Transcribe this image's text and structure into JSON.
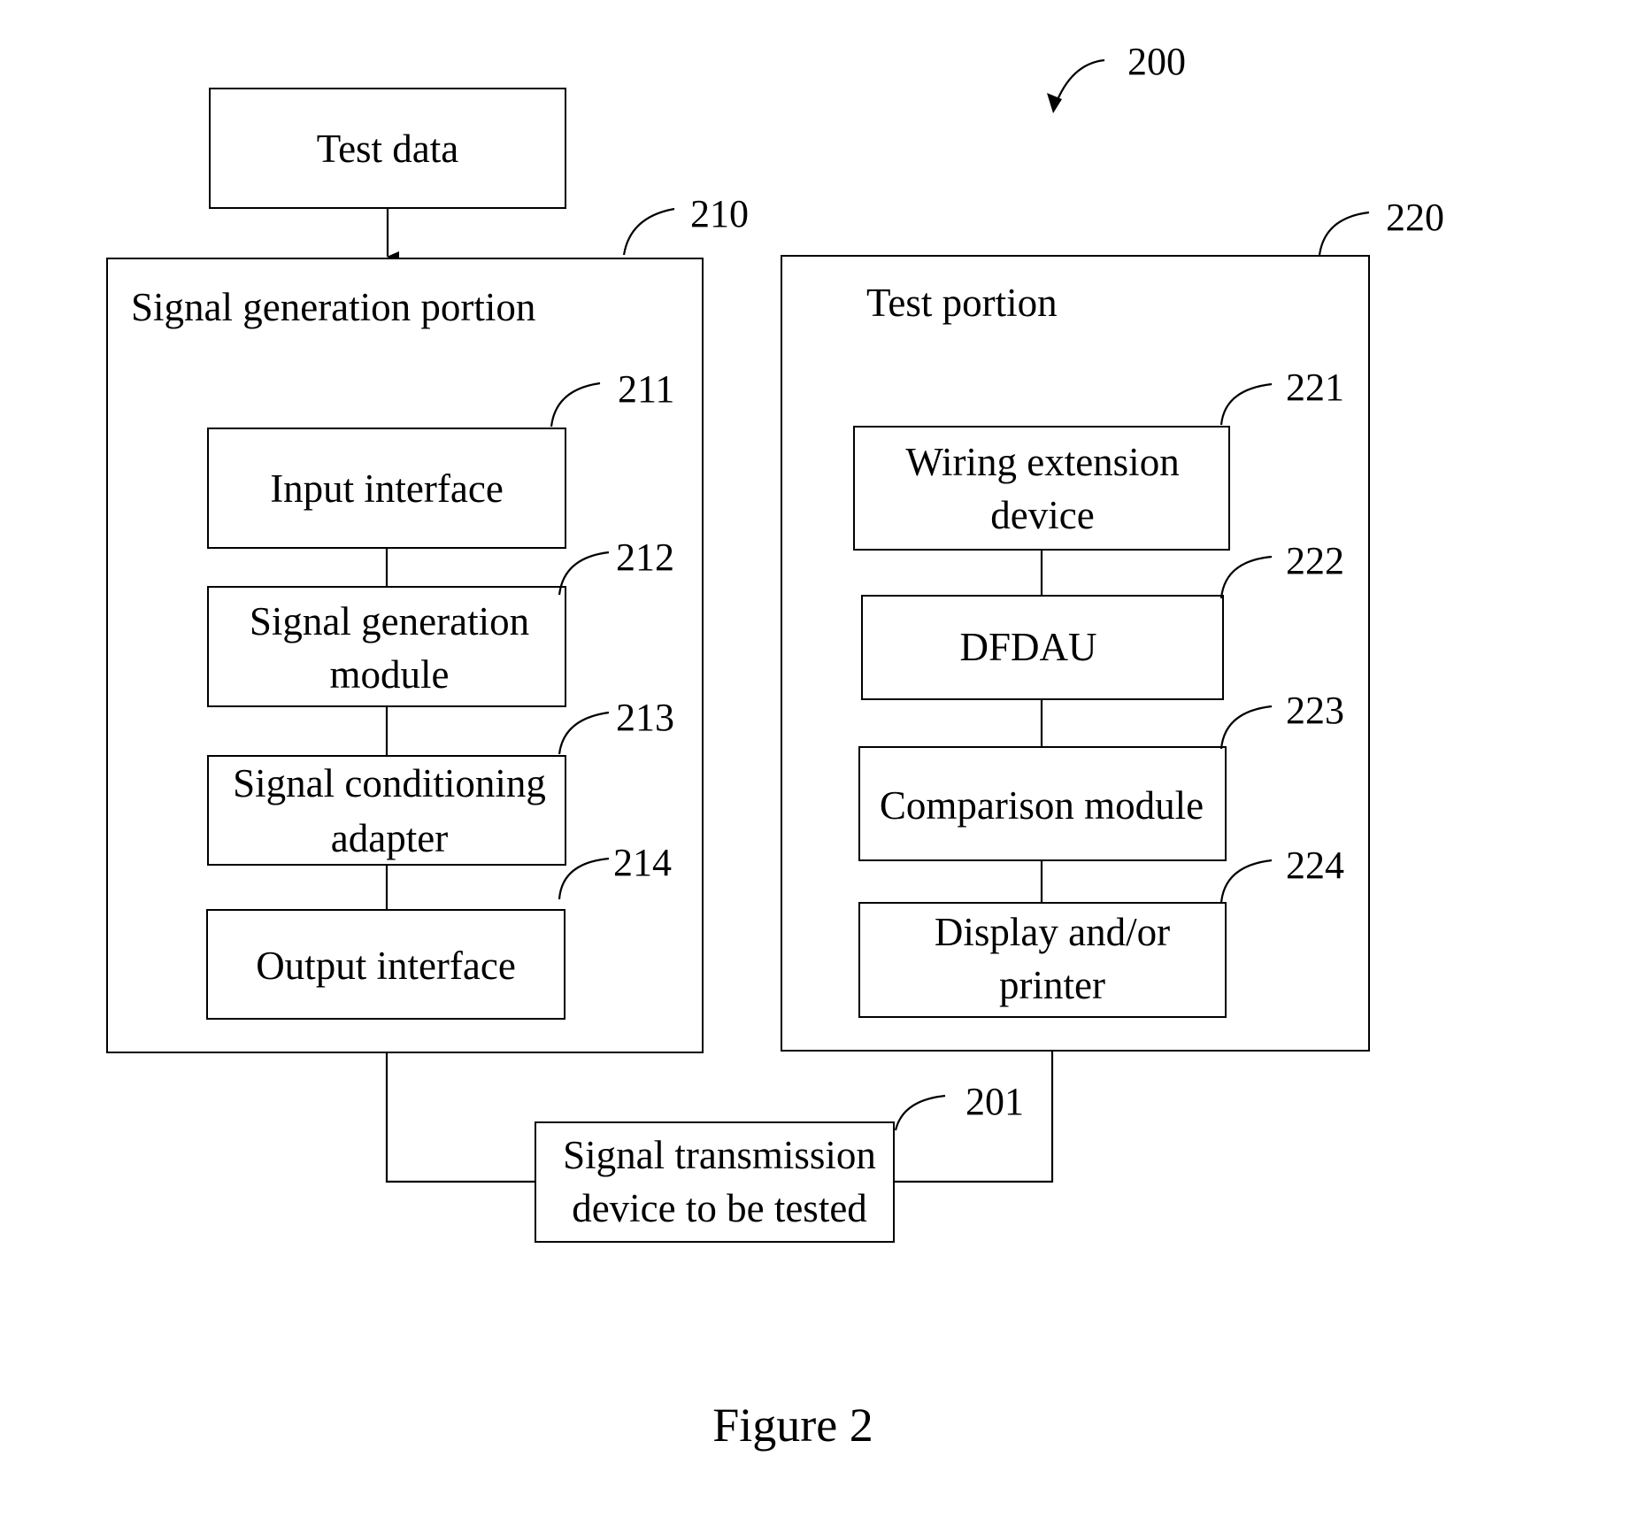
{
  "figure": {
    "ref": "200",
    "caption": "Figure 2"
  },
  "test_data": {
    "label": "Test data"
  },
  "signal_generation_portion": {
    "ref": "210",
    "title": "Signal generation portion",
    "modules": [
      {
        "ref": "211",
        "lines": [
          "Input interface"
        ]
      },
      {
        "ref": "212",
        "lines": [
          "Signal generation",
          "module"
        ]
      },
      {
        "ref": "213",
        "lines": [
          "Signal conditioning",
          "adapter"
        ]
      },
      {
        "ref": "214",
        "lines": [
          "Output interface"
        ]
      }
    ]
  },
  "test_portion": {
    "ref": "220",
    "title": "Test portion",
    "modules": [
      {
        "ref": "221",
        "lines": [
          "Wiring extension",
          "device"
        ]
      },
      {
        "ref": "222",
        "lines": [
          "DFDAU"
        ]
      },
      {
        "ref": "223",
        "lines": [
          "Comparison module"
        ]
      },
      {
        "ref": "224",
        "lines": [
          "Display and/or",
          "printer"
        ]
      }
    ]
  },
  "device_under_test": {
    "ref": "201",
    "lines": [
      "Signal transmission",
      "device to be tested"
    ]
  }
}
